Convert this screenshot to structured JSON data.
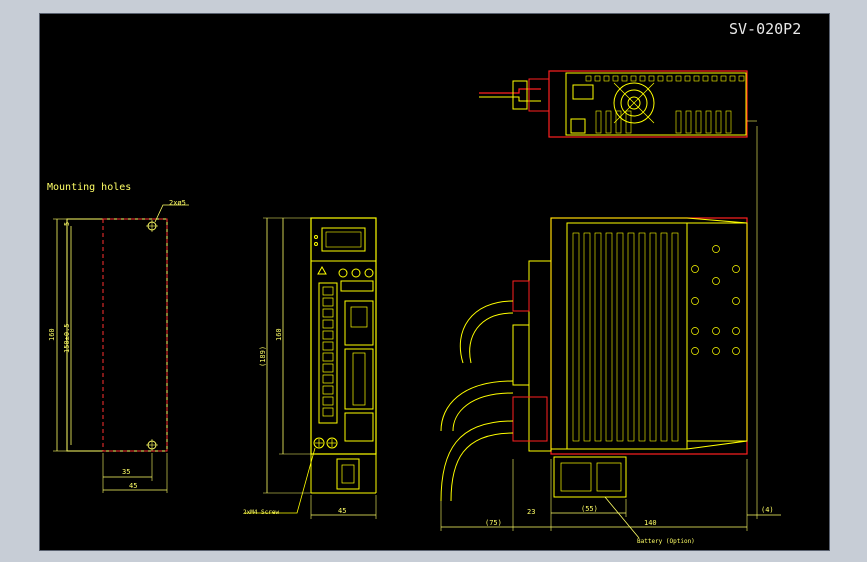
{
  "title": "SV-020P2",
  "labels": {
    "mounting_holes": "Mounting holes",
    "hole_callout": "2xø5",
    "screw_callout": "2xM4 Screw",
    "battery_callout": "Battery (Option)"
  },
  "dimensions": {
    "mount_height": "160",
    "mount_pitch": "150±0.5",
    "mount_top_offset": "5",
    "mount_hole_spacing": "35",
    "mount_width": "45",
    "front_height": "160",
    "front_overall_height": "(189)",
    "front_width": "45",
    "side_cable": "(75)",
    "side_offset": "23",
    "side_battery": "(55)",
    "side_depth": "140",
    "side_right": "(4)"
  },
  "colors": {
    "background": "#000000",
    "outline": "#ffff00",
    "body": "#ff2020",
    "text": "#ffff66",
    "title": "#ffffff"
  }
}
